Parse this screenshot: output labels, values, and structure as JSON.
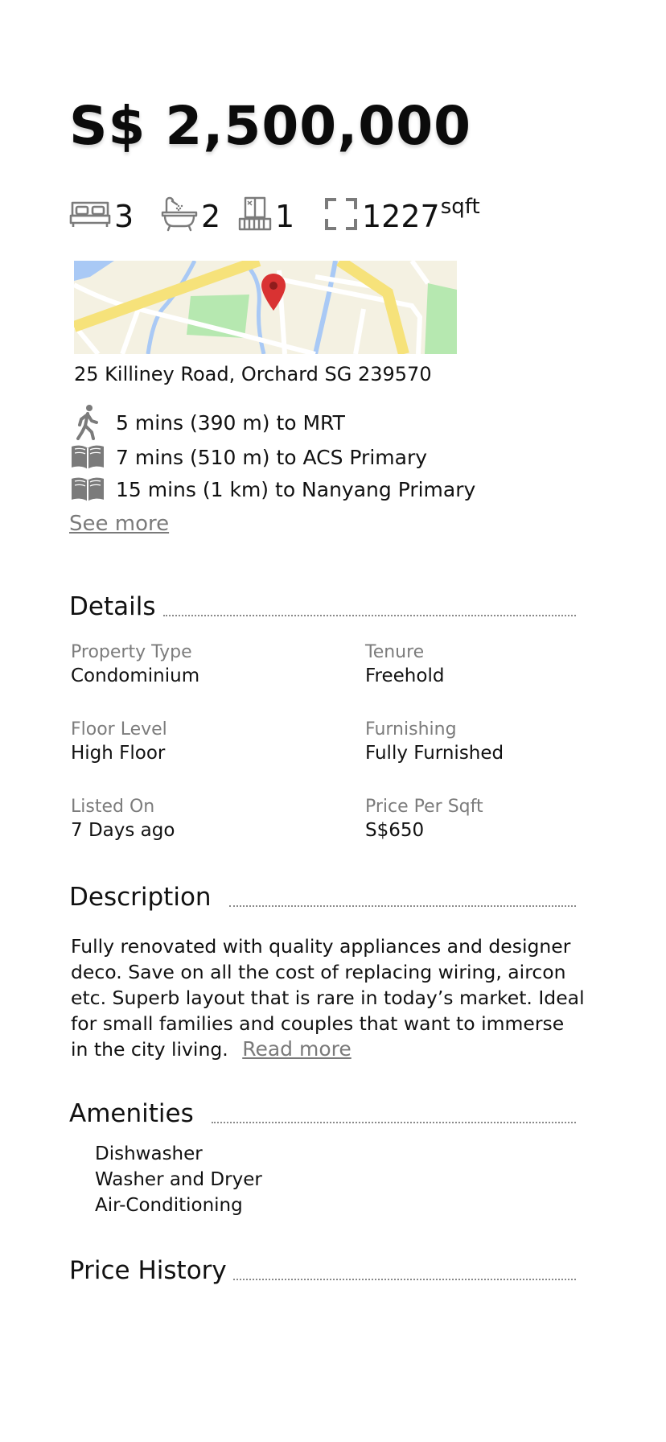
{
  "listing": {
    "price": "S$ 2,500,000",
    "bedrooms": "3",
    "bathrooms": "2",
    "balconies": "1",
    "area_value": "1227",
    "area_unit": "sqft",
    "address": "25 Killiney Road, Orchard SG 239570"
  },
  "icons": {
    "bed": "bed-icon",
    "bath": "bathtub-icon",
    "balcony": "balcony-icon",
    "area": "area-frame-icon",
    "map_pin": "map-pin-icon",
    "walk": "walking-person-icon",
    "school": "open-book-icon"
  },
  "proximity": [
    {
      "icon": "walking-person-icon",
      "text": "5 mins (390 m) to MRT"
    },
    {
      "icon": "open-book-icon",
      "text": "7 mins (510 m) to ACS Primary"
    },
    {
      "icon": "open-book-icon",
      "text": "15 mins (1 km) to Nanyang Primary"
    }
  ],
  "see_more": "See more",
  "details": {
    "title": "Details",
    "items": [
      {
        "label": "Property Type",
        "value": "Condominium"
      },
      {
        "label": "Tenure",
        "value": "Freehold"
      },
      {
        "label": "Floor Level",
        "value": "High Floor"
      },
      {
        "label": "Furnishing",
        "value": "Fully Furnished"
      },
      {
        "label": "Listed On",
        "value": "7 Days ago"
      },
      {
        "label": "Price Per Sqft",
        "value": "S$650"
      }
    ]
  },
  "description": {
    "title": "Description",
    "text": "Fully renovated with quality appliances and designer deco. Save on all the cost of replacing wiring, aircon etc. Superb layout that is rare in today’s market. Ideal for small families and couples that want to immerse in the city living.",
    "read_more": "Read more"
  },
  "amenities": {
    "title": "Amenities",
    "items": [
      "Dishwasher",
      "Washer and Dryer",
      "Air-Conditioning"
    ]
  },
  "price_history": {
    "title": "Price History"
  },
  "colors": {
    "map_land": "#f4f1e2",
    "map_road_major": "#f6e27a",
    "map_water": "#a9c9f5",
    "map_park": "#b6e8b0",
    "pin": "#d93232",
    "icon_gray": "#7b7b7b"
  }
}
